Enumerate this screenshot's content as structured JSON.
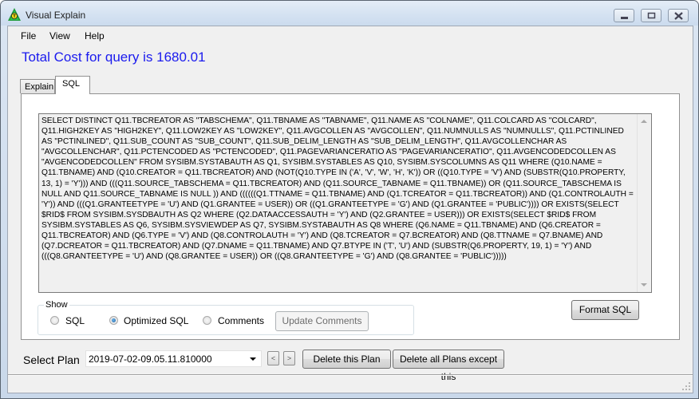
{
  "window": {
    "title": "Visual Explain",
    "icon": "visual-explain-app-icon",
    "controls": [
      "minimize",
      "maximize",
      "close"
    ]
  },
  "menu": {
    "items": [
      {
        "label": "File"
      },
      {
        "label": "View"
      },
      {
        "label": "Help"
      }
    ]
  },
  "header": {
    "cost_text": "Total Cost for query is 1680.01",
    "cost_color": "#1a1aee"
  },
  "tabs": [
    {
      "label": "Explain",
      "active": false
    },
    {
      "label": "SQL",
      "active": true
    }
  ],
  "sql_panel": {
    "text": "SELECT DISTINCT Q11.TBCREATOR AS \"TABSCHEMA\", Q11.TBNAME AS \"TABNAME\", Q11.NAME AS \"COLNAME\", Q11.COLCARD AS \"COLCARD\", Q11.HIGH2KEY AS \"HIGH2KEY\", Q11.LOW2KEY AS \"LOW2KEY\", Q11.AVGCOLLEN AS \"AVGCOLLEN\", Q11.NUMNULLS AS \"NUMNULLS\", Q11.PCTINLINED AS \"PCTINLINED\", Q11.SUB_COUNT AS \"SUB_COUNT\", Q11.SUB_DELIM_LENGTH AS \"SUB_DELIM_LENGTH\", Q11.AVGCOLLENCHAR AS \"AVGCOLLENCHAR\", Q11.PCTENCODED AS \"PCTENCODED\", Q11.PAGEVARIANCERATIO AS \"PAGEVARIANCERATIO\", Q11.AVGENCODEDCOLLEN AS \"AVGENCODEDCOLLEN\" FROM SYSIBM.SYSTABAUTH AS Q1, SYSIBM.SYSTABLES AS Q10, SYSIBM.SYSCOLUMNS AS Q11 WHERE (Q10.NAME = Q11.TBNAME) AND (Q10.CREATOR = Q11.TBCREATOR) AND (NOT(Q10.TYPE IN ('A', 'V', 'W', 'H', 'K')) OR ((Q10.TYPE = 'V') AND (SUBSTR(Q10.PROPERTY, 13, 1) = 'Y'))) AND (((Q11.SOURCE_TABSCHEMA = Q11.TBCREATOR) AND (Q11.SOURCE_TABNAME = Q11.TBNAME)) OR (Q11.SOURCE_TABSCHEMA IS NULL AND Q11.SOURCE_TABNAME IS NULL )) AND ((((((Q1.TTNAME = Q11.TBNAME) AND (Q1.TCREATOR = Q11.TBCREATOR)) AND (Q1.CONTROLAUTH = 'Y')) AND (((Q1.GRANTEETYPE = 'U') AND (Q1.GRANTEE = USER)) OR ((Q1.GRANTEETYPE = 'G') AND (Q1.GRANTEE = 'PUBLIC')))) OR EXISTS(SELECT $RID$ FROM SYSIBM.SYSDBAUTH AS Q2 WHERE (Q2.DATAACCESSAUTH = 'Y') AND (Q2.GRANTEE = USER))) OR EXISTS(SELECT $RID$ FROM SYSIBM.SYSTABLES AS Q6, SYSIBM.SYSVIEWDEP AS Q7, SYSIBM.SYSTABAUTH AS Q8 WHERE (Q6.NAME = Q11.TBNAME) AND (Q6.CREATOR = Q11.TBCREATOR) AND (Q6.TYPE = 'V') AND (Q8.CONTROLAUTH = 'Y') AND (Q8.TCREATOR = Q7.BCREATOR) AND (Q8.TTNAME = Q7.BNAME) AND (Q7.DCREATOR = Q11.TBCREATOR) AND (Q7.DNAME = Q11.TBNAME) AND Q7.BTYPE IN ('T', 'U') AND (SUBSTR(Q6.PROPERTY, 19, 1) = 'Y') AND (((Q8.GRANTEETYPE = 'U') AND (Q8.GRANTEE = USER)) OR ((Q8.GRANTEETYPE = 'G') AND (Q8.GRANTEE = 'PUBLIC')))))"
  },
  "show_group": {
    "legend": "Show",
    "options": [
      {
        "label": "SQL",
        "checked": false
      },
      {
        "label": "Optimized SQL",
        "checked": true
      },
      {
        "label": "Comments",
        "checked": false
      }
    ],
    "update_button": {
      "label": "Update Comments",
      "enabled": false
    }
  },
  "format_button": {
    "label": "Format SQL"
  },
  "plan": {
    "label": "Select Plan",
    "selected": "2019-07-02-09.05.11.810000",
    "prev_label": "<",
    "next_label": ">",
    "delete_label": "Delete this Plan",
    "delete_others_label": "Delete all Plans except this"
  }
}
